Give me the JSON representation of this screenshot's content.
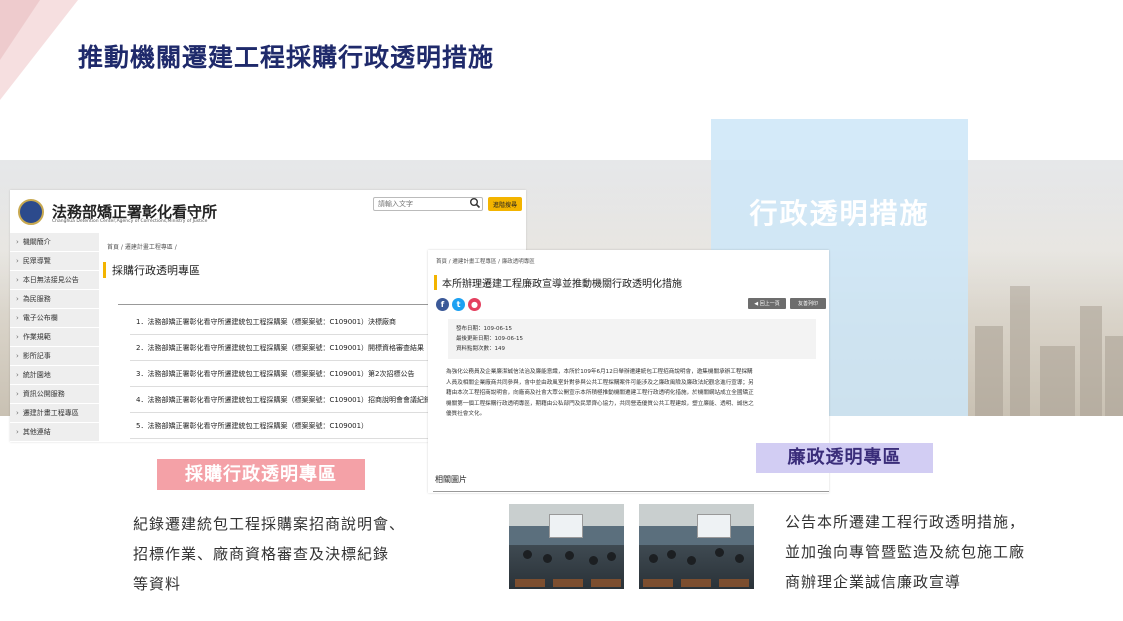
{
  "slide": {
    "title": "推動機關遷建工程採購行政透明措施"
  },
  "highlight_panel": {
    "title": "行政透明措施"
  },
  "website_left": {
    "org_name": "法務部矯正署彰化看守所",
    "org_name_en": "Changhua Detention Center,Agency of Corrections,Ministry of Justice",
    "search_placeholder": "請輸入文字",
    "advanced_search_label": "進階搜尋",
    "sidebar_items": [
      "機關簡介",
      "民眾導覽",
      "本日無法接見公告",
      "為民服務",
      "電子公布欄",
      "作業規範",
      "影所記事",
      "統計園地",
      "資訊公開服務",
      "遷建計畫工程專區",
      "其他連結"
    ],
    "breadcrumb": "首頁 / 遷建計畫工程專區 /",
    "page_title": "採購行政透明專區",
    "list_items": [
      "1．法務部矯正署彰化看守所遷建統包工程採購案（標案案號：C109001）決標廠商",
      "2．法務部矯正署彰化看守所遷建統包工程採購案（標案案號：C109001）開標資格審查結果",
      "3．法務部矯正署彰化看守所遷建統包工程採購案（標案案號：C109001）第2次招標公告",
      "4．法務部矯正署彰化看守所遷建統包工程採購案（標案案號：C109001）招商說明會會議紀錄",
      "5．法務部矯正署彰化看守所遷建統包工程採購案（標案案號：C109001）"
    ]
  },
  "left_caption": {
    "label": "採購行政透明專區",
    "lines": [
      "紀錄遷建統包工程採購案招商說明會、",
      "招標作業、廠商資格審查及決標紀錄",
      "等資料"
    ]
  },
  "website_right": {
    "breadcrumb": "首頁 / 遷建計畫工程專區 / 廉政透明專區",
    "title": "本所辦理遷建工程廉政宣導並推動機關行政透明化措施",
    "back_label": "◀ 回上一頁",
    "print_label": "友善列印",
    "meta": [
      "發布日期：109-06-15",
      "最後更新日期：109-06-15",
      "資料點閱次數：149"
    ],
    "body_lines": [
      "為強化公務員及企業廉潔誠信法治及廉能意識，本所於109年6月12日舉辦遷建統包工程招商說明會，邀集機關承辦工程採購",
      "人員及相關企業廠商共同參與，會中並由政風室針對參與公共工程採購案件可能涉及之廉政風險及廉政法紀觀念進行宣導；另",
      "藉由本次工程招商說明會，向廠商及社會大眾公開宣示本所積極推動機關遷建工程行政透明化措施，於機關網站成立全國矯正",
      "機關第一個工程採購行政透明專區，期藉由公私部門及民眾齊心協力，共同營造優質公共工程建設，塑立廉能、透明、誠信之",
      "優質社會文化。"
    ],
    "related_label": "相關圖片"
  },
  "right_caption": {
    "label": "廉政透明專區",
    "lines": [
      "公告本所遷建工程行政透明措施，",
      "並加強向專管暨監造及統包施工廠",
      "商辦理企業誠信廉政宣導"
    ]
  },
  "colors": {
    "title": "#1f2a6b",
    "pink_label": "#f4a1a7",
    "purple_label": "#d2cdf3",
    "accent": "#f3b400",
    "panel_blue": "#cce6f8"
  }
}
